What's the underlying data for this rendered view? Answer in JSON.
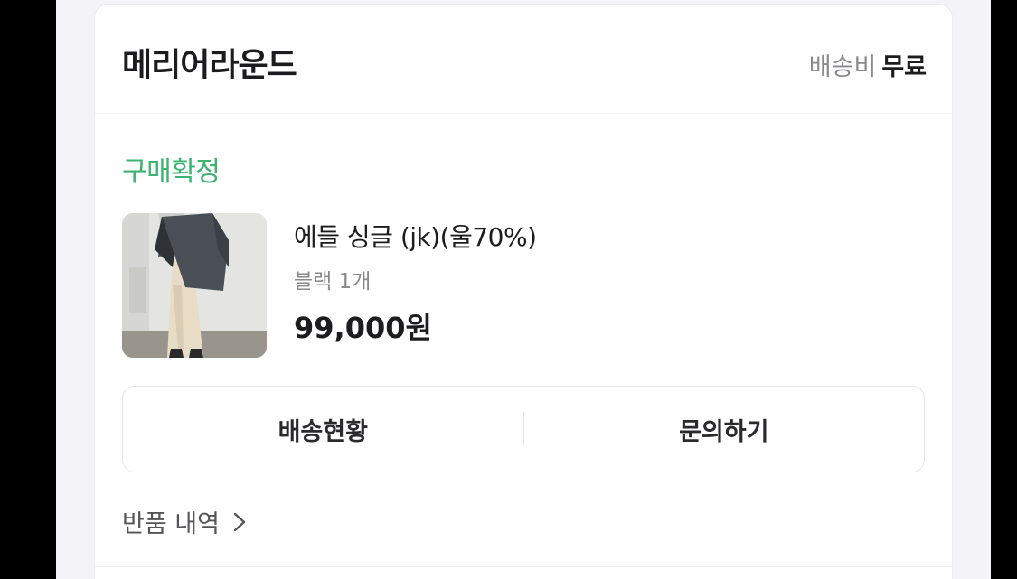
{
  "header": {
    "store_name": "메리어라운드",
    "shipping_label": "배송비",
    "shipping_value": "무료"
  },
  "order": {
    "status": "구매확정",
    "status_color": "#3cb371"
  },
  "product": {
    "name": "에들 싱글 (jk)(울70%)",
    "option": "블랙 1개",
    "price": "99,000원"
  },
  "actions": {
    "delivery_status": "배송현황",
    "inquiry": "문의하기"
  },
  "returns": {
    "label": "반품 내역",
    "icon": "chevron-right-icon"
  }
}
